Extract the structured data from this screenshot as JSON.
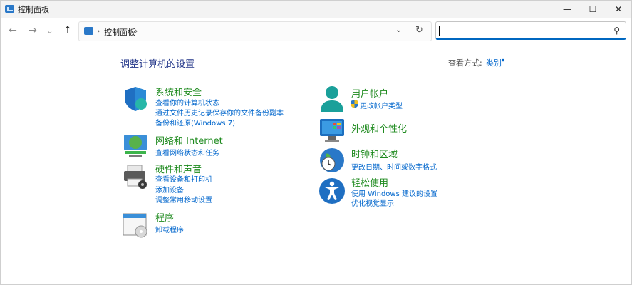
{
  "window": {
    "title": "控制面板",
    "min_glyph": "—",
    "max_glyph": "☐",
    "close_glyph": "✕"
  },
  "nav": {
    "back_glyph": "←",
    "forward_glyph": "→",
    "recent_glyph": "⌄",
    "up_glyph": "↑"
  },
  "address": {
    "separator": "›",
    "path": "控制面板",
    "dropdown_glyph": "⌄",
    "refresh_glyph": "↻"
  },
  "search": {
    "value": "",
    "icon_glyph": "⚲"
  },
  "main": {
    "title": "调整计算机的设置",
    "view_by_label": "查看方式:",
    "view_by_value": "类别",
    "view_by_caret": "▾"
  },
  "categories": [
    {
      "icon": "shield-icon",
      "title": "系统和安全",
      "links": [
        "查看你的计算机状态",
        "通过文件历史记录保存你的文件备份副本",
        "备份和还原(Windows 7)"
      ]
    },
    {
      "icon": "network-icon",
      "title": "网络和 Internet",
      "links": [
        "查看网络状态和任务"
      ]
    },
    {
      "icon": "printer-icon",
      "title": "硬件和声音",
      "links": [
        "查看设备和打印机",
        "添加设备",
        "调整常用移动设置"
      ]
    },
    {
      "icon": "programs-icon",
      "title": "程序",
      "links": [
        "卸载程序"
      ]
    },
    {
      "icon": "user-icon",
      "title": "用户帐户",
      "links": [
        "更改帐户类型"
      ]
    },
    {
      "icon": "appearance-icon",
      "title": "外观和个性化",
      "links": []
    },
    {
      "icon": "clock-globe-icon",
      "title": "时钟和区域",
      "links": [
        "更改日期、时间或数字格式"
      ]
    },
    {
      "icon": "accessibility-icon",
      "title": "轻松使用",
      "links": [
        "使用 Windows 建议的设置",
        "优化视觉显示"
      ]
    }
  ]
}
